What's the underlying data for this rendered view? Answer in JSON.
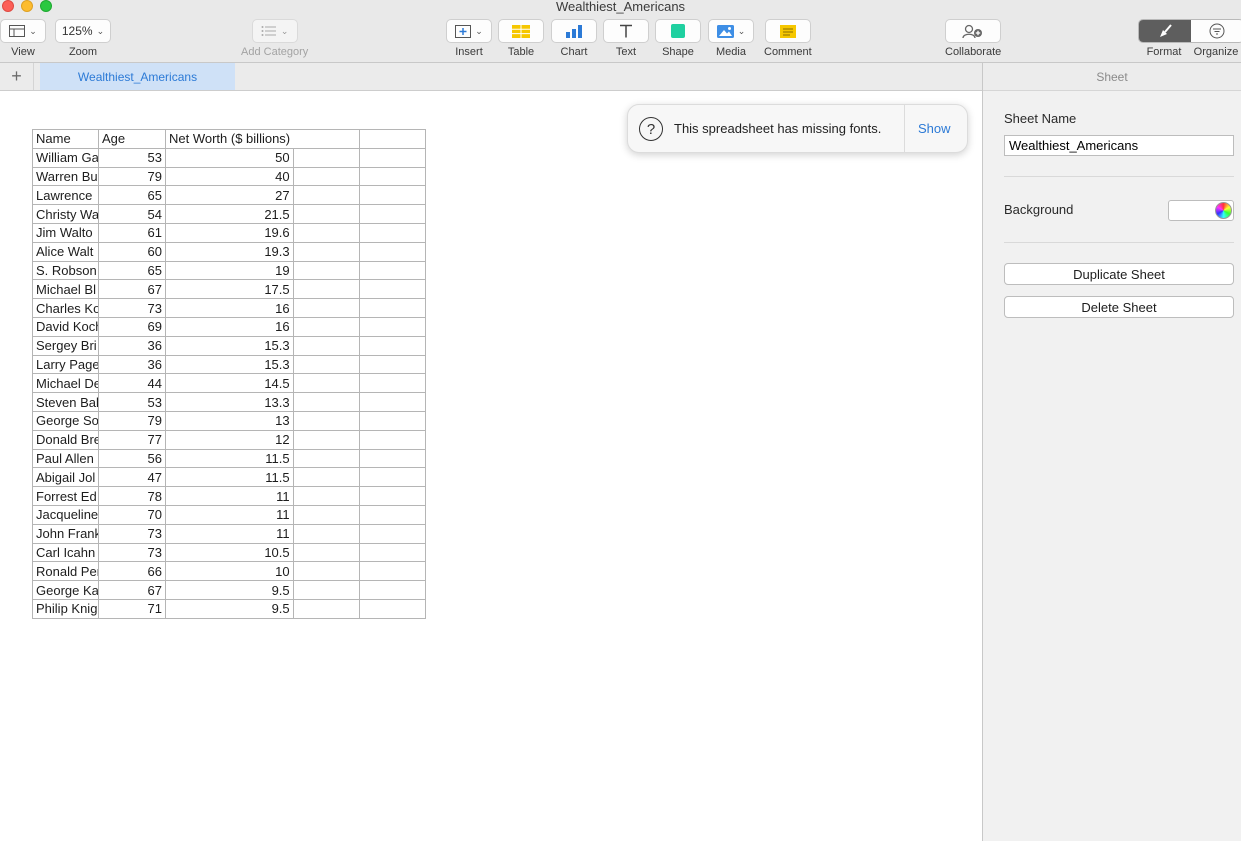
{
  "window": {
    "title": "Wealthiest_Americans"
  },
  "toolbar": {
    "view_label": "View",
    "zoom_value": "125%",
    "zoom_label": "Zoom",
    "add_category_label": "Add Category",
    "insert_label": "Insert",
    "table_label": "Table",
    "chart_label": "Chart",
    "text_label": "Text",
    "shape_label": "Shape",
    "media_label": "Media",
    "comment_label": "Comment",
    "collaborate_label": "Collaborate",
    "format_label": "Format",
    "organize_label": "Organize"
  },
  "tabs": {
    "active_sheet": "Wealthiest_Americans"
  },
  "banner": {
    "message": "This spreadsheet has missing fonts.",
    "action": "Show"
  },
  "table": {
    "headers": [
      "Name",
      "Age",
      "Net Worth ($ billions)"
    ],
    "rows": [
      [
        "William Ga",
        "53",
        "50"
      ],
      [
        "Warren Bu",
        "79",
        "40"
      ],
      [
        "Lawrence",
        "65",
        "27"
      ],
      [
        "Christy Wa",
        "54",
        "21.5"
      ],
      [
        "Jim Walto",
        "61",
        "19.6"
      ],
      [
        "Alice Walt",
        "60",
        "19.3"
      ],
      [
        "S. Robson",
        "65",
        "19"
      ],
      [
        "Michael Bl",
        "67",
        "17.5"
      ],
      [
        "Charles Ko",
        "73",
        "16"
      ],
      [
        "David Koch",
        "69",
        "16"
      ],
      [
        "Sergey Bri",
        "36",
        "15.3"
      ],
      [
        "Larry Page",
        "36",
        "15.3"
      ],
      [
        "Michael De",
        "44",
        "14.5"
      ],
      [
        "Steven Bal",
        "53",
        "13.3"
      ],
      [
        "George So",
        "79",
        "13"
      ],
      [
        "Donald Bre",
        "77",
        "12"
      ],
      [
        "Paul Allen",
        "56",
        "11.5"
      ],
      [
        "Abigail Jol",
        "47",
        "11.5"
      ],
      [
        "Forrest Ed",
        "78",
        "11"
      ],
      [
        "Jacqueline",
        "70",
        "11"
      ],
      [
        "John Frank",
        "73",
        "11"
      ],
      [
        "Carl Icahn",
        "73",
        "10.5"
      ],
      [
        "Ronald Per",
        "66",
        "10"
      ],
      [
        "George Ka",
        "67",
        "9.5"
      ],
      [
        "Philip Knig",
        "71",
        "9.5"
      ]
    ]
  },
  "inspector": {
    "header": "Sheet",
    "sheet_name_label": "Sheet Name",
    "sheet_name_value": "Wealthiest_Americans",
    "background_label": "Background",
    "duplicate_label": "Duplicate Sheet",
    "delete_label": "Delete Sheet"
  }
}
